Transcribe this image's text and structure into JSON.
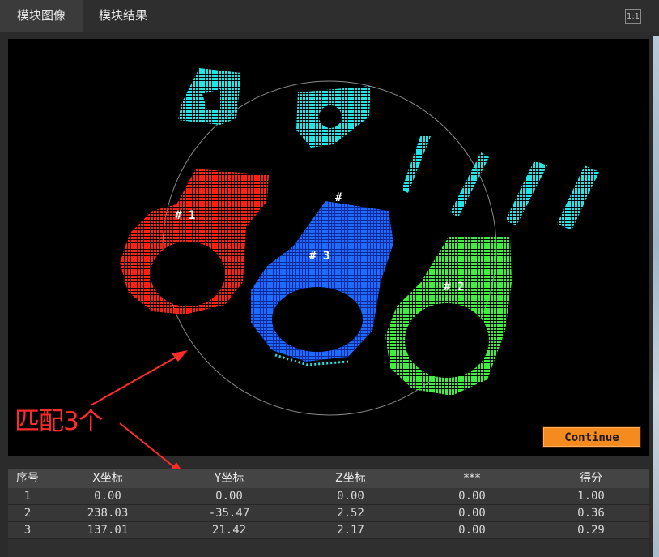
{
  "tabs": [
    {
      "label": "模块图像",
      "active": true
    },
    {
      "label": "模块结果",
      "active": false
    }
  ],
  "toolbar": {
    "one_to_one_label": "1:1"
  },
  "viewer": {
    "labels": [
      "# 1",
      "# 2",
      "# 3",
      "#"
    ],
    "continue_label": "Continue",
    "colors": {
      "red": "#ff2010",
      "blue": "#1a5cff",
      "green": "#32e63a",
      "cyan": "#22e6e6",
      "accent": "#f58a1f"
    }
  },
  "annotation": {
    "text": "匹配3个",
    "color": "#ff2a2a"
  },
  "results_table": {
    "headers": [
      "序号",
      "X坐标",
      "Y坐标",
      "Z坐标",
      "***",
      "得分"
    ],
    "rows": [
      [
        "1",
        "0.00",
        "0.00",
        "0.00",
        "0.00",
        "1.00"
      ],
      [
        "2",
        "238.03",
        "-35.47",
        "2.52",
        "0.00",
        "0.36"
      ],
      [
        "3",
        "137.01",
        "21.42",
        "2.17",
        "0.00",
        "0.29"
      ]
    ]
  }
}
